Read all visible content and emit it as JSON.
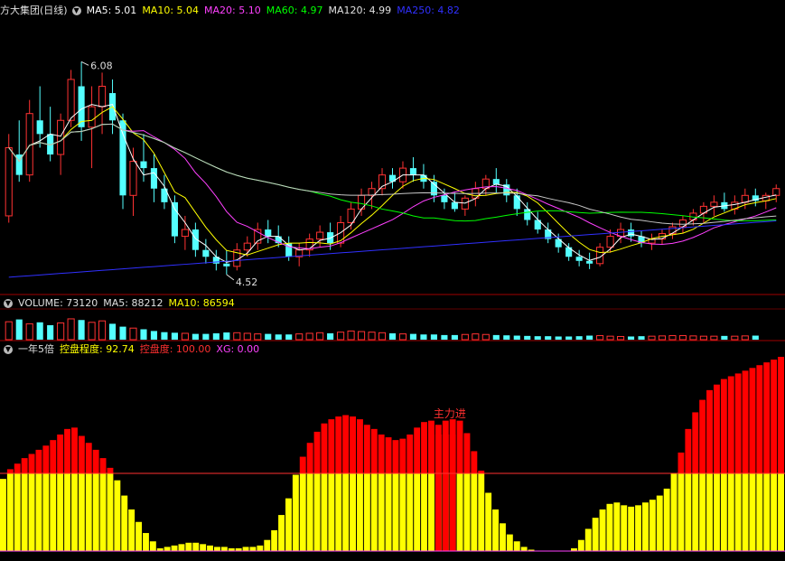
{
  "colors": {
    "bg": "#000000",
    "up": "#ff3232",
    "down": "#54ffff",
    "grid": "#a00000",
    "ma5": "#ffffff",
    "ma10": "#ffff00",
    "ma20": "#ff40ff",
    "ma60": "#00ff00",
    "ma120": "#c8c8c8",
    "ma250": "#3030ff",
    "bar_red": "#ff0000",
    "bar_yellow": "#ffff00"
  },
  "price_panel": {
    "title": "方大集团(日线)",
    "toggle_icon": "chevron-down-icon",
    "ma_labels": [
      {
        "text": "MA5: 5.01",
        "color": "#ffffff"
      },
      {
        "text": "MA10: 5.04",
        "color": "#ffff00"
      },
      {
        "text": "MA20: 5.10",
        "color": "#ff40ff"
      },
      {
        "text": "MA60: 4.97",
        "color": "#00ff00"
      },
      {
        "text": "MA120: 4.99",
        "color": "#e0e0e0"
      },
      {
        "text": "MA250: 4.82",
        "color": "#3030ff"
      }
    ],
    "high_label": "6.08",
    "low_label": "4.52"
  },
  "volume_panel": {
    "labels": [
      {
        "text": "VOLUME: 73120",
        "color": "#e0e0e0"
      },
      {
        "text": "MA5: 88212",
        "color": "#e0e0e0"
      },
      {
        "text": "MA10: 86594",
        "color": "#ffff00"
      }
    ]
  },
  "indicator_panel": {
    "title": "一年5倍",
    "labels": [
      {
        "text": "控盘程度: 92.74",
        "color": "#ffff00"
      },
      {
        "text": "控盘度: 100.00",
        "color": "#ff3030"
      },
      {
        "text": "XG: 0.00",
        "color": "#ff40ff"
      }
    ],
    "annotation": "主力进"
  },
  "chart_data": {
    "type": "candlestick",
    "price_range": [
      4.4,
      6.4
    ],
    "candles": [
      {
        "o": 4.95,
        "h": 5.55,
        "l": 4.9,
        "c": 5.45
      },
      {
        "o": 5.4,
        "h": 5.65,
        "l": 5.2,
        "c": 5.25
      },
      {
        "o": 5.25,
        "h": 5.8,
        "l": 5.2,
        "c": 5.7
      },
      {
        "o": 5.65,
        "h": 5.9,
        "l": 5.45,
        "c": 5.55
      },
      {
        "o": 5.55,
        "h": 5.75,
        "l": 5.35,
        "c": 5.4
      },
      {
        "o": 5.4,
        "h": 5.7,
        "l": 5.25,
        "c": 5.65
      },
      {
        "o": 5.65,
        "h": 6.02,
        "l": 5.6,
        "c": 5.95
      },
      {
        "o": 5.9,
        "h": 6.08,
        "l": 5.5,
        "c": 5.6
      },
      {
        "o": 5.6,
        "h": 5.9,
        "l": 5.3,
        "c": 5.75
      },
      {
        "o": 5.75,
        "h": 6.0,
        "l": 5.55,
        "c": 5.9
      },
      {
        "o": 5.85,
        "h": 5.95,
        "l": 5.55,
        "c": 5.65
      },
      {
        "o": 5.65,
        "h": 5.7,
        "l": 5.0,
        "c": 5.1
      },
      {
        "o": 5.1,
        "h": 5.45,
        "l": 4.95,
        "c": 5.35
      },
      {
        "o": 5.35,
        "h": 5.55,
        "l": 5.2,
        "c": 5.3
      },
      {
        "o": 5.3,
        "h": 5.4,
        "l": 5.05,
        "c": 5.15
      },
      {
        "o": 5.15,
        "h": 5.25,
        "l": 5.0,
        "c": 5.05
      },
      {
        "o": 5.05,
        "h": 5.1,
        "l": 4.75,
        "c": 4.8
      },
      {
        "o": 4.8,
        "h": 4.95,
        "l": 4.7,
        "c": 4.85
      },
      {
        "o": 4.85,
        "h": 4.9,
        "l": 4.65,
        "c": 4.7
      },
      {
        "o": 4.7,
        "h": 4.78,
        "l": 4.6,
        "c": 4.65
      },
      {
        "o": 4.65,
        "h": 4.7,
        "l": 4.55,
        "c": 4.6
      },
      {
        "o": 4.6,
        "h": 4.7,
        "l": 4.52,
        "c": 4.58
      },
      {
        "o": 4.58,
        "h": 4.75,
        "l": 4.55,
        "c": 4.7
      },
      {
        "o": 4.7,
        "h": 4.8,
        "l": 4.65,
        "c": 4.75
      },
      {
        "o": 4.75,
        "h": 4.9,
        "l": 4.7,
        "c": 4.85
      },
      {
        "o": 4.85,
        "h": 4.92,
        "l": 4.75,
        "c": 4.8
      },
      {
        "o": 4.8,
        "h": 4.88,
        "l": 4.72,
        "c": 4.75
      },
      {
        "o": 4.75,
        "h": 4.8,
        "l": 4.62,
        "c": 4.65
      },
      {
        "o": 4.65,
        "h": 4.75,
        "l": 4.58,
        "c": 4.7
      },
      {
        "o": 4.7,
        "h": 4.82,
        "l": 4.65,
        "c": 4.78
      },
      {
        "o": 4.78,
        "h": 4.88,
        "l": 4.72,
        "c": 4.83
      },
      {
        "o": 4.83,
        "h": 4.9,
        "l": 4.7,
        "c": 4.75
      },
      {
        "o": 4.75,
        "h": 4.95,
        "l": 4.72,
        "c": 4.9
      },
      {
        "o": 4.9,
        "h": 5.05,
        "l": 4.85,
        "c": 5.0
      },
      {
        "o": 5.0,
        "h": 5.15,
        "l": 4.95,
        "c": 5.1
      },
      {
        "o": 5.1,
        "h": 5.2,
        "l": 5.0,
        "c": 5.15
      },
      {
        "o": 5.15,
        "h": 5.3,
        "l": 5.1,
        "c": 5.25
      },
      {
        "o": 5.25,
        "h": 5.3,
        "l": 5.15,
        "c": 5.2
      },
      {
        "o": 5.2,
        "h": 5.35,
        "l": 5.15,
        "c": 5.3
      },
      {
        "o": 5.3,
        "h": 5.38,
        "l": 5.2,
        "c": 5.25
      },
      {
        "o": 5.25,
        "h": 5.33,
        "l": 5.15,
        "c": 5.2
      },
      {
        "o": 5.2,
        "h": 5.25,
        "l": 5.05,
        "c": 5.1
      },
      {
        "o": 5.1,
        "h": 5.15,
        "l": 5.0,
        "c": 5.05
      },
      {
        "o": 5.05,
        "h": 5.12,
        "l": 4.98,
        "c": 5.0
      },
      {
        "o": 5.0,
        "h": 5.1,
        "l": 4.95,
        "c": 5.08
      },
      {
        "o": 5.08,
        "h": 5.2,
        "l": 5.02,
        "c": 5.15
      },
      {
        "o": 5.15,
        "h": 5.25,
        "l": 5.1,
        "c": 5.22
      },
      {
        "o": 5.22,
        "h": 5.3,
        "l": 5.12,
        "c": 5.18
      },
      {
        "o": 5.18,
        "h": 5.22,
        "l": 5.05,
        "c": 5.1
      },
      {
        "o": 5.1,
        "h": 5.15,
        "l": 4.95,
        "c": 5.0
      },
      {
        "o": 5.0,
        "h": 5.05,
        "l": 4.88,
        "c": 4.92
      },
      {
        "o": 4.92,
        "h": 4.98,
        "l": 4.82,
        "c": 4.85
      },
      {
        "o": 4.85,
        "h": 4.9,
        "l": 4.75,
        "c": 4.78
      },
      {
        "o": 4.78,
        "h": 4.82,
        "l": 4.68,
        "c": 4.72
      },
      {
        "o": 4.72,
        "h": 4.75,
        "l": 4.62,
        "c": 4.65
      },
      {
        "o": 4.65,
        "h": 4.7,
        "l": 4.58,
        "c": 4.62
      },
      {
        "o": 4.62,
        "h": 4.68,
        "l": 4.56,
        "c": 4.6
      },
      {
        "o": 4.6,
        "h": 4.75,
        "l": 4.58,
        "c": 4.72
      },
      {
        "o": 4.72,
        "h": 4.85,
        "l": 4.68,
        "c": 4.8
      },
      {
        "o": 4.8,
        "h": 4.9,
        "l": 4.75,
        "c": 4.85
      },
      {
        "o": 4.85,
        "h": 4.9,
        "l": 4.76,
        "c": 4.8
      },
      {
        "o": 4.8,
        "h": 4.84,
        "l": 4.72,
        "c": 4.75
      },
      {
        "o": 4.75,
        "h": 4.82,
        "l": 4.7,
        "c": 4.78
      },
      {
        "o": 4.78,
        "h": 4.85,
        "l": 4.74,
        "c": 4.82
      },
      {
        "o": 4.82,
        "h": 4.9,
        "l": 4.78,
        "c": 4.87
      },
      {
        "o": 4.87,
        "h": 4.95,
        "l": 4.82,
        "c": 4.92
      },
      {
        "o": 4.92,
        "h": 5.0,
        "l": 4.88,
        "c": 4.97
      },
      {
        "o": 4.97,
        "h": 5.05,
        "l": 4.9,
        "c": 5.02
      },
      {
        "o": 5.02,
        "h": 5.1,
        "l": 4.95,
        "c": 5.05
      },
      {
        "o": 5.05,
        "h": 5.12,
        "l": 4.98,
        "c": 5.0
      },
      {
        "o": 5.0,
        "h": 5.1,
        "l": 4.96,
        "c": 5.05
      },
      {
        "o": 5.05,
        "h": 5.15,
        "l": 5.0,
        "c": 5.1
      },
      {
        "o": 5.1,
        "h": 5.15,
        "l": 5.02,
        "c": 5.06
      },
      {
        "o": 5.06,
        "h": 5.12,
        "l": 5.0,
        "c": 5.1
      },
      {
        "o": 5.1,
        "h": 5.18,
        "l": 5.05,
        "c": 5.15
      }
    ],
    "volume": [
      0.62,
      0.7,
      0.55,
      0.6,
      0.5,
      0.58,
      0.72,
      0.68,
      0.6,
      0.65,
      0.55,
      0.45,
      0.4,
      0.36,
      0.3,
      0.26,
      0.24,
      0.22,
      0.2,
      0.2,
      0.22,
      0.25,
      0.24,
      0.22,
      0.2,
      0.2,
      0.18,
      0.18,
      0.2,
      0.22,
      0.24,
      0.22,
      0.26,
      0.3,
      0.28,
      0.26,
      0.24,
      0.22,
      0.2,
      0.2,
      0.18,
      0.18,
      0.16,
      0.16,
      0.18,
      0.2,
      0.18,
      0.16,
      0.15,
      0.14,
      0.13,
      0.12,
      0.12,
      0.11,
      0.11,
      0.12,
      0.14,
      0.14,
      0.12,
      0.11,
      0.11,
      0.12,
      0.12,
      0.13,
      0.14,
      0.14,
      0.13,
      0.12,
      0.12,
      0.13,
      0.12,
      0.13,
      0.14
    ],
    "control_degree": [
      52,
      59,
      63,
      67,
      70,
      73,
      76,
      80,
      84,
      88,
      89,
      83,
      78,
      73,
      67,
      60,
      51,
      40,
      30,
      21,
      13,
      7,
      2,
      3,
      4,
      5,
      6,
      6,
      5,
      4,
      3,
      3,
      2,
      2,
      3,
      3,
      4,
      8,
      15,
      26,
      38,
      55,
      68,
      78,
      86,
      92,
      95,
      97,
      98,
      97,
      95,
      91,
      88,
      84,
      82,
      80,
      81,
      84,
      89,
      93,
      94,
      91,
      94,
      95,
      94,
      85,
      72,
      58,
      42,
      30,
      20,
      12,
      7,
      3,
      1,
      0,
      0,
      0,
      0,
      0,
      2,
      8,
      16,
      24,
      30,
      34,
      35,
      33,
      32,
      33,
      35,
      37,
      40,
      45,
      56,
      71,
      88,
      100,
      109,
      116,
      120,
      124,
      126,
      128,
      130,
      132,
      134,
      136,
      138,
      140
    ],
    "main_entry_bars": [
      61,
      62,
      63
    ]
  }
}
